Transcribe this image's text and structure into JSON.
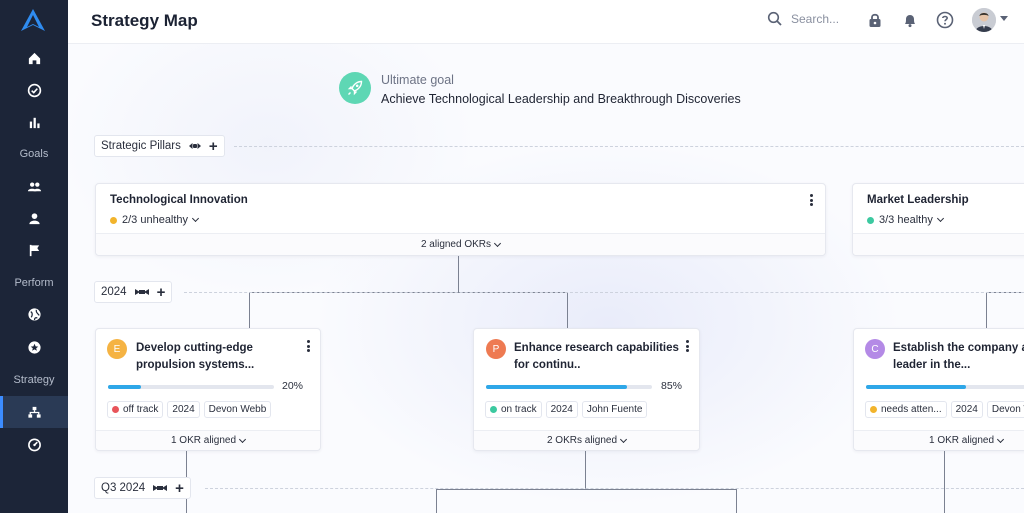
{
  "header": {
    "title": "Strategy Map",
    "search_placeholder": "Search..."
  },
  "sidebar": {
    "sections": {
      "goals": "Goals",
      "perform": "Perform",
      "strategy": "Strategy"
    },
    "icons": [
      "home-icon",
      "check-circle-icon",
      "bar-chart-icon",
      "team-icon",
      "user-icon",
      "flag-icon",
      "globe-icon",
      "star-badge-icon",
      "org-chart-icon",
      "gauge-icon"
    ]
  },
  "goal": {
    "label": "Ultimate goal",
    "title": "Achieve Technological Leadership and Breakthrough Discoveries"
  },
  "rows": {
    "pillars": "Strategic Pillars",
    "year": "2024",
    "quarter": "Q3 2024"
  },
  "pillars": [
    {
      "title": "Technological Innovation",
      "status": "2/3 unhealthy",
      "status_color": "#f2b42c",
      "footer": "2 aligned OKRs"
    },
    {
      "title": "Market Leadership",
      "status": "3/3 healthy",
      "status_color": "#3cc9a0",
      "footer": ""
    }
  ],
  "okrs": [
    {
      "badge": "E",
      "badge_color": "#f5b343",
      "title_line1": "Develop cutting-edge",
      "title_line2": "propulsion systems...",
      "progress": 20,
      "progress_label": "20%",
      "status": "off track",
      "status_color": "#e8545a",
      "year": "2024",
      "owner": "Devon Webb",
      "footer": "1 OKR aligned"
    },
    {
      "badge": "P",
      "badge_color": "#ee7a52",
      "title_line1": "Enhance research capabilities",
      "title_line2": "for continu..",
      "progress": 85,
      "progress_label": "85%",
      "status": "on track",
      "status_color": "#3cc9a0",
      "year": "2024",
      "owner": "John Fuente",
      "footer": "2 OKRs aligned"
    },
    {
      "badge": "C",
      "badge_color": "#b48ae6",
      "title_line1": "Establish the company as",
      "title_line2": "leader in the...",
      "progress": 60,
      "progress_label": "",
      "status": "needs atten...",
      "status_color": "#f2b42c",
      "year": "2024",
      "owner": "Devon W",
      "footer": "1 OKR aligned"
    }
  ]
}
